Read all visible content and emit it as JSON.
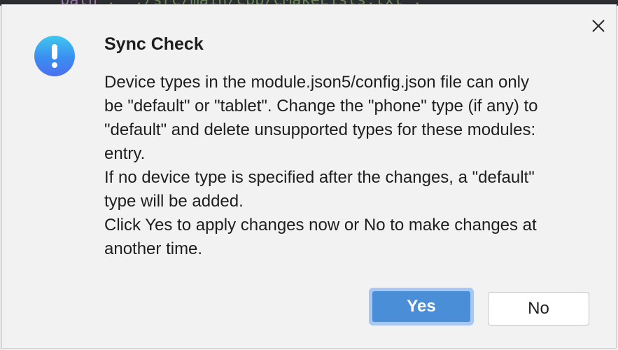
{
  "background": {
    "code_key": "path",
    "code_value": "\"./src/main/cpp/CMakeLists.txt\","
  },
  "dialog": {
    "title": "Sync Check",
    "icon": "info-icon",
    "message_lines": [
      "Device types in the module.json5/config.json file can only",
      "be \"default\" or \"tablet\". Change the \"phone\" type (if any) to",
      "\"default\" and delete unsupported types for these modules:",
      "entry.",
      "If no device type is specified after the changes, a \"default\"",
      "type will be added.",
      "Click Yes to apply changes now or No to make changes at",
      "another time."
    ],
    "buttons": {
      "yes_label": "Yes",
      "no_label": "No"
    },
    "close_icon": "close-icon"
  },
  "colors": {
    "accent": "#4a8ed8",
    "focus_ring": "#a7c8f2",
    "icon_gradient_top": "#3fc8ee",
    "icon_gradient_bottom": "#4b6ff0"
  }
}
